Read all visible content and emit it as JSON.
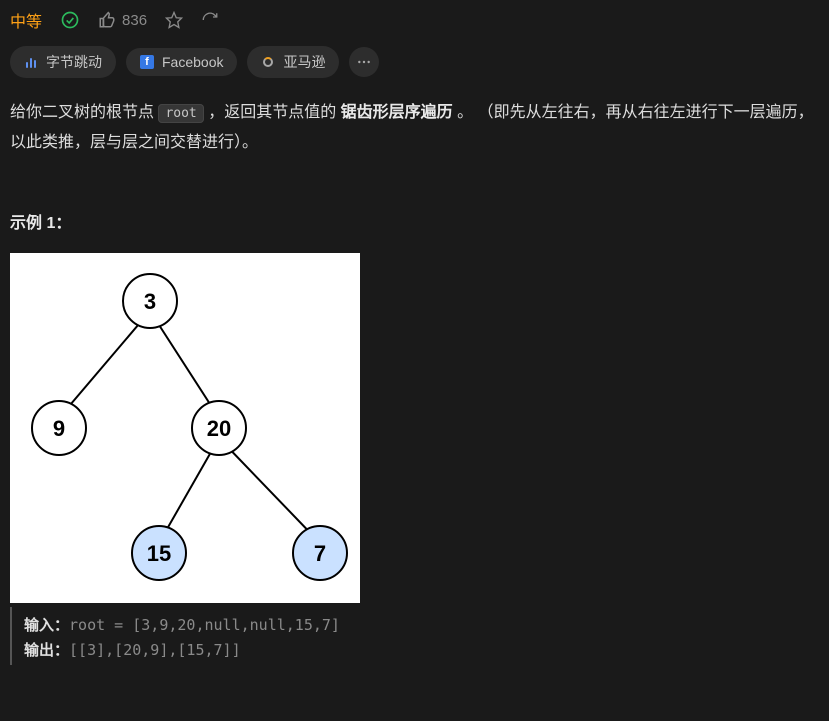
{
  "meta": {
    "difficulty": "中等",
    "likes": "836"
  },
  "tags": {
    "t0": "字节跳动",
    "t1": "Facebook",
    "t2": "亚马逊"
  },
  "desc": {
    "pre": "给你二叉树的根节点 ",
    "code": "root",
    "mid": " ，返回其节点值的 ",
    "bold": "锯齿形层序遍历",
    "post": " 。 （即先从左往右，再从右往左进行下一层遍历，以此类推，层与层之间交替进行）。"
  },
  "example": {
    "title": "示例 1：",
    "input_label": "输入：",
    "input_code": "root = [3,9,20,null,null,15,7]",
    "output_label": "输出：",
    "output_code": "[[3],[20,9],[15,7]]"
  },
  "chart_data": {
    "type": "tree",
    "nodes": {
      "n3": {
        "label": "3",
        "children": [
          "n9",
          "n20"
        ],
        "fill": "#ffffff"
      },
      "n9": {
        "label": "9",
        "children": [],
        "fill": "#ffffff"
      },
      "n20": {
        "label": "20",
        "children": [
          "n15",
          "n7"
        ],
        "fill": "#ffffff"
      },
      "n15": {
        "label": "15",
        "children": [],
        "fill": "#cae1ff"
      },
      "n7": {
        "label": "7",
        "children": [],
        "fill": "#cae1ff"
      }
    },
    "root": "n3"
  }
}
